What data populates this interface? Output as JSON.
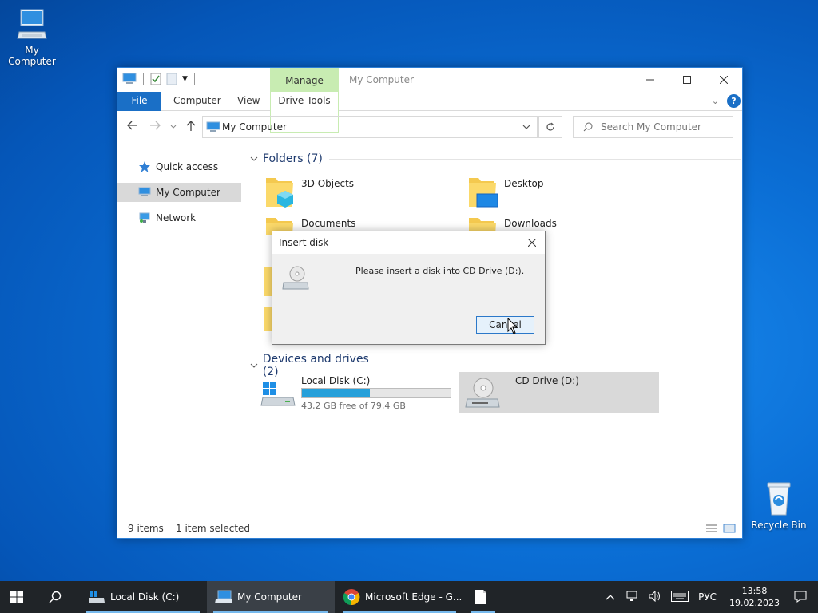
{
  "desktop": {
    "icons": [
      {
        "label": "My Computer"
      },
      {
        "label": "Recycle Bin"
      }
    ]
  },
  "window": {
    "title": "My Computer",
    "context_tab": "Manage",
    "ribbon_tabs": [
      "File",
      "Computer",
      "View",
      "Drive Tools"
    ],
    "address_path": "My Computer",
    "search_placeholder": "Search My Computer"
  },
  "nav_pane": {
    "items": [
      "Quick access",
      "My Computer",
      "Network"
    ]
  },
  "content": {
    "folders_header": "Folders (7)",
    "folders": [
      "3D Objects",
      "Desktop",
      "Documents",
      "Downloads"
    ],
    "drives_header": "Devices and drives (2)",
    "drives": [
      {
        "name": "Local Disk (C:)",
        "free": "43,2 GB free of 79,4 GB",
        "used_fraction": 0.456
      },
      {
        "name": "CD Drive (D:)"
      }
    ]
  },
  "status": {
    "items": "9 items",
    "selected": "1 item selected"
  },
  "dialog": {
    "title": "Insert disk",
    "message": "Please insert a disk into CD Drive (D:).",
    "button": "Cancel"
  },
  "taskbar": {
    "items": [
      "Local Disk (C:)",
      "My Computer",
      "Microsoft Edge - G..."
    ],
    "language": "РУС",
    "time": "13:58",
    "date": "19.02.2023"
  },
  "colors": {
    "accent": "#1a6fc6",
    "manage_tab": "#c8ecb2",
    "progress": "#26a0da"
  }
}
